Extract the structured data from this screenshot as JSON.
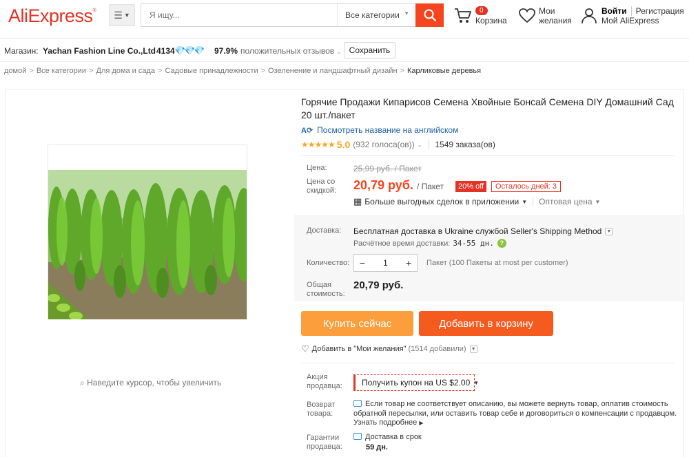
{
  "header": {
    "logo": "AliExpress",
    "logo_mark": "®",
    "search_placeholder": "Я ищу...",
    "category_label": "Все категории",
    "cart_count": "0",
    "cart_label": "Корзина",
    "wishlist_line1": "Мои",
    "wishlist_line2": "желания",
    "login": "Войти",
    "register": "Регистрация",
    "my_account": "Мой AliExpress"
  },
  "store": {
    "label": "Магазин:",
    "name": "Yachan Fashion Line Co.,Ltd",
    "score": "4134",
    "positive": "97.9%",
    "positive_label": "положительных отзывов",
    "save_label": "Сохранить"
  },
  "breadcrumb": [
    "домой",
    "Все категории",
    "Для дома и сада",
    "Садовые принадлежности",
    "Озеленение и ландшафтный дизайн",
    "Карликовые деревья"
  ],
  "gallery": {
    "zoom_hint": "Наведите курсор, чтобы увеличить"
  },
  "product": {
    "title": "Горячие Продажи Кипарисов Семена Хвойные Бонсай Семена DIY Домашний Сад 20 шт./пакет",
    "english_link": "Посмотреть название на английском",
    "rating_score": "5.0",
    "rating_votes": "(932 голоса(ов))",
    "orders": "1549 заказа(ов)",
    "price_label": "Цена:",
    "old_price": "25,99 руб. / Пакет",
    "discount_label_1": "Цена со",
    "discount_label_2": "скидкой:",
    "new_price": "20,79 руб.",
    "price_unit": "/ Пакет",
    "off_badge": "20% off",
    "days_left": "Осталось дней: 3",
    "app_deals": "Больше выгодных сделок в приложении",
    "wholesale": "Оптовая цена",
    "shipping_label": "Доставка:",
    "shipping_text": "Бесплатная доставка в Ukraine службой Seller's Shipping Method",
    "delivery_label": "Расчётное время доставки:",
    "delivery_time": "34-55 дн.",
    "quantity_label": "Количество:",
    "quantity_value": "1",
    "quantity_note": "Пакет (100 Пакеты at most per customer)",
    "total_label_1": "Общая",
    "total_label_2": "стоимость:",
    "total": "20,79 руб.",
    "buy_now": "Купить сейчас",
    "add_to_cart": "Добавить в корзину",
    "add_wish": "Добавить в \"Мои желания\"",
    "wish_count": "(1514 добавили)",
    "promo_label_1": "Акция",
    "promo_label_2": "продавца:",
    "coupon": "Получить купон на US $2.00",
    "return_label_1": "Возврат",
    "return_label_2": "товара:",
    "return_text": "Если товар не соответствует описанию, вы можете вернуть товар, оплатив стоимость обратной пересылки, или оставить товар себе и договориться о компенсации с продавцом.",
    "return_link": "Узнать подробнее",
    "guarantee_label_1": "Гарантии",
    "guarantee_label_2": "продавца:",
    "guarantee_text": "Доставка в срок",
    "guarantee_days": "59 дн."
  },
  "colors": {
    "brand": "#e43225",
    "search_button": "#f5451f",
    "buy_now": "#fb9e3b",
    "add_to_cart": "#f55a1f",
    "rating": "#f5a623",
    "link": "#1f5fa8"
  }
}
